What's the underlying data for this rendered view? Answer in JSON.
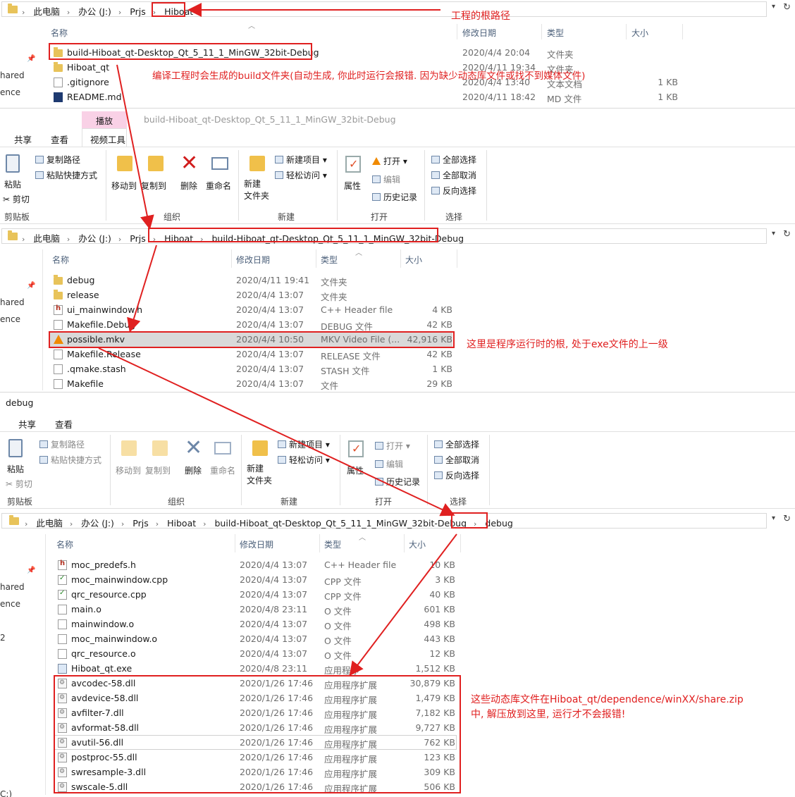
{
  "panel1": {
    "crumbs": [
      "此电脑",
      "办公 (J:)",
      "Prjs",
      "Hiboat"
    ],
    "cols": {
      "name": "名称",
      "date": "修改日期",
      "type": "类型",
      "size": "大小"
    },
    "left": [
      "hared",
      "ence"
    ],
    "rows": [
      {
        "name": "build-Hiboat_qt-Desktop_Qt_5_11_1_MinGW_32bit-Debug",
        "date": "2020/4/4 20:04",
        "type": "文件夹",
        "size": "",
        "icon": "folder"
      },
      {
        "name": "Hiboat_qt",
        "date": "2020/4/11 19:34",
        "type": "文件夹",
        "size": "",
        "icon": "folder"
      },
      {
        "name": ".gitignore",
        "date": "2020/4/4 13:40",
        "type": "文本文档",
        "size": "1 KB",
        "icon": "file"
      },
      {
        "name": "README.md",
        "date": "2020/4/11 18:42",
        "type": "MD 文件",
        "size": "1 KB",
        "icon": "md"
      }
    ]
  },
  "ribbon1": {
    "context_tab": "播放",
    "window_title": "build-Hiboat_qt-Desktop_Qt_5_11_1_MinGW_32bit-Debug",
    "tabs": [
      "共享",
      "查看",
      "视频工具"
    ],
    "paste": "粘贴",
    "copy_path": "复制路径",
    "paste_shortcut": "粘贴快捷方式",
    "cut": "剪切",
    "clipboard": "剪贴板",
    "move_to": "移动到",
    "copy_to": "复制到",
    "delete": "删除",
    "rename": "重命名",
    "organize": "组织",
    "new_folder": "新建\n文件夹",
    "new_item": "新建项目",
    "easy_access": "轻松访问",
    "new": "新建",
    "properties": "属性",
    "open": "打开",
    "edit": "编辑",
    "history": "历史记录",
    "open_group": "打开",
    "select_all": "全部选择",
    "select_none": "全部取消",
    "invert": "反向选择",
    "select": "选择"
  },
  "panel2": {
    "crumbs": [
      "此电脑",
      "办公 (J:)",
      "Prjs",
      "Hiboat",
      "build-Hiboat_qt-Desktop_Qt_5_11_1_MinGW_32bit-Debug"
    ],
    "cols": {
      "name": "名称",
      "date": "修改日期",
      "type": "类型",
      "size": "大小"
    },
    "left": [
      "hared",
      "ence"
    ],
    "rows": [
      {
        "name": "debug",
        "date": "2020/4/11 19:41",
        "type": "文件夹",
        "size": "",
        "icon": "folder"
      },
      {
        "name": "release",
        "date": "2020/4/4 13:07",
        "type": "文件夹",
        "size": "",
        "icon": "folder"
      },
      {
        "name": "ui_mainwindow.h",
        "date": "2020/4/4 13:07",
        "type": "C++ Header file",
        "size": "4 KB",
        "icon": "hfile"
      },
      {
        "name": "Makefile.Debug",
        "date": "2020/4/4 13:07",
        "type": "DEBUG 文件",
        "size": "42 KB",
        "icon": "file"
      },
      {
        "name": "possible.mkv",
        "date": "2020/4/4 10:50",
        "type": "MKV Video File (...",
        "size": "42,916 KB",
        "icon": "vlc"
      },
      {
        "name": "Makefile.Release",
        "date": "2020/4/4 13:07",
        "type": "RELEASE 文件",
        "size": "42 KB",
        "icon": "file"
      },
      {
        "name": ".qmake.stash",
        "date": "2020/4/4 13:07",
        "type": "STASH 文件",
        "size": "1 KB",
        "icon": "file"
      },
      {
        "name": "Makefile",
        "date": "2020/4/4 13:07",
        "type": "文件",
        "size": "29 KB",
        "icon": "file"
      }
    ]
  },
  "ribbon2": {
    "window_title": "debug",
    "tabs": [
      "共享",
      "查看"
    ]
  },
  "panel3": {
    "crumbs": [
      "此电脑",
      "办公 (J:)",
      "Prjs",
      "Hiboat",
      "build-Hiboat_qt-Desktop_Qt_5_11_1_MinGW_32bit-Debug",
      "debug"
    ],
    "cols": {
      "name": "名称",
      "date": "修改日期",
      "type": "类型",
      "size": "大小"
    },
    "left": [
      "hared",
      "ence",
      "2",
      "C:)"
    ],
    "rows": [
      {
        "name": "moc_predefs.h",
        "date": "2020/4/4 13:07",
        "type": "C++ Header file",
        "size": "10 KB",
        "icon": "hfile"
      },
      {
        "name": "moc_mainwindow.cpp",
        "date": "2020/4/4 13:07",
        "type": "CPP 文件",
        "size": "3 KB",
        "icon": "cpp"
      },
      {
        "name": "qrc_resource.cpp",
        "date": "2020/4/4 13:07",
        "type": "CPP 文件",
        "size": "40 KB",
        "icon": "cpp"
      },
      {
        "name": "main.o",
        "date": "2020/4/8 23:11",
        "type": "O 文件",
        "size": "601 KB",
        "icon": "file"
      },
      {
        "name": "mainwindow.o",
        "date": "2020/4/4 13:07",
        "type": "O 文件",
        "size": "498 KB",
        "icon": "file"
      },
      {
        "name": "moc_mainwindow.o",
        "date": "2020/4/4 13:07",
        "type": "O 文件",
        "size": "443 KB",
        "icon": "file"
      },
      {
        "name": "qrc_resource.o",
        "date": "2020/4/4 13:07",
        "type": "O 文件",
        "size": "12 KB",
        "icon": "file"
      },
      {
        "name": "Hiboat_qt.exe",
        "date": "2020/4/8 23:11",
        "type": "应用程序",
        "size": "1,512 KB",
        "icon": "exe"
      },
      {
        "name": "avcodec-58.dll",
        "date": "2020/1/26 17:46",
        "type": "应用程序扩展",
        "size": "30,879 KB",
        "icon": "dll"
      },
      {
        "name": "avdevice-58.dll",
        "date": "2020/1/26 17:46",
        "type": "应用程序扩展",
        "size": "1,479 KB",
        "icon": "dll"
      },
      {
        "name": "avfilter-7.dll",
        "date": "2020/1/26 17:46",
        "type": "应用程序扩展",
        "size": "7,182 KB",
        "icon": "dll"
      },
      {
        "name": "avformat-58.dll",
        "date": "2020/1/26 17:46",
        "type": "应用程序扩展",
        "size": "9,727 KB",
        "icon": "dll"
      },
      {
        "name": "avutil-56.dll",
        "date": "2020/1/26 17:46",
        "type": "应用程序扩展",
        "size": "762 KB",
        "icon": "dll"
      },
      {
        "name": "postproc-55.dll",
        "date": "2020/1/26 17:46",
        "type": "应用程序扩展",
        "size": "123 KB",
        "icon": "dll"
      },
      {
        "name": "swresample-3.dll",
        "date": "2020/1/26 17:46",
        "type": "应用程序扩展",
        "size": "309 KB",
        "icon": "dll"
      },
      {
        "name": "swscale-5.dll",
        "date": "2020/1/26 17:46",
        "type": "应用程序扩展",
        "size": "506 KB",
        "icon": "dll"
      }
    ]
  },
  "annotations": {
    "root": "工程的根路径",
    "build": "编译工程时会生成的build文件夹(自动生成, 你此时运行会报错. 因为缺少动态库文件或找不到媒体文件)",
    "run_root": "这里是程序运行时的根, 处于exe文件的上一级",
    "dll_line1": "这些动态库文件在Hiboat_qt/dependence/winXX/share.zip",
    "dll_line2": "中, 解压放到这里, 运行才不会报错!"
  },
  "colors": {
    "annotation": "#e02020",
    "selected_row": "#d9d9d9",
    "context_tab": "#f9d1e6"
  }
}
